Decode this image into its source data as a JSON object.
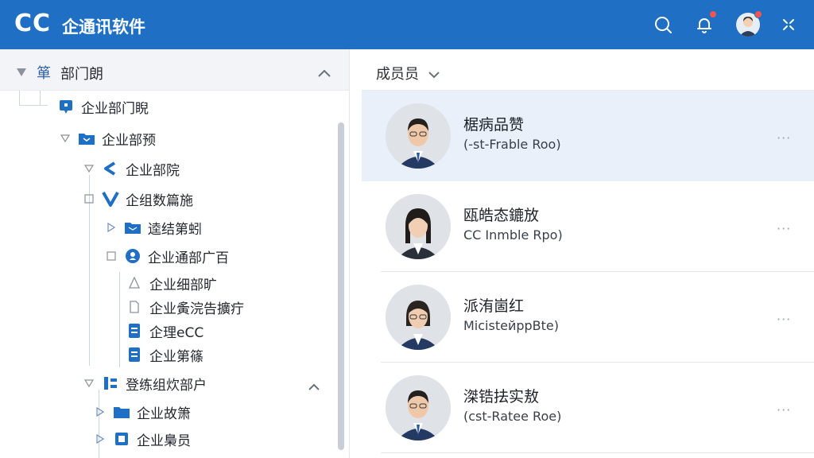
{
  "header": {
    "logo": "CC",
    "title": "企通讯软件",
    "icons": [
      "search-icon",
      "bell-icon",
      "user-avatar",
      "close-icon"
    ],
    "colors": {
      "bar": "#1f6fc4",
      "badge": "#f05454"
    }
  },
  "tree": {
    "header_glyph": "箪",
    "header_label": "部门朗",
    "nodes": [
      {
        "label": "企业部门睨",
        "icon": "chat-bubble-icon"
      },
      {
        "label": "企业部预",
        "icon": "folder-icon"
      },
      {
        "label": "企业部院",
        "icon": "chevron-shape-icon"
      },
      {
        "label": "企组数篇施",
        "icon": "v-logo-icon"
      },
      {
        "label": "逵结第蚓",
        "icon": "folder-icon"
      },
      {
        "label": "企业通部广百",
        "icon": "person-circle-icon"
      },
      {
        "label": "企业细部旷",
        "icon": "outline-icon"
      },
      {
        "label": "企业夤浣告擴疔",
        "icon": "outline-doc-icon"
      },
      {
        "label": "企理eCC",
        "icon": "document-icon"
      },
      {
        "label": "企业第篠",
        "icon": "document-icon"
      },
      {
        "label": "登练组炊部户",
        "icon": "structure-icon"
      },
      {
        "label": "企业故箫",
        "icon": "folder-icon"
      },
      {
        "label": "企业梟员",
        "icon": "square-icon"
      }
    ]
  },
  "members": {
    "header": "成员员",
    "items": [
      {
        "name": "椐病品赞",
        "role": "(-st-Frable Roo)"
      },
      {
        "name": "瓯皓态鏕放",
        "role": "CC Inmble Rpo)"
      },
      {
        "name": "派洧崮红",
        "role": "MicisteйppBte)"
      },
      {
        "name": "滐锆抾实敖",
        "role": "(cst-Ratee Roe)"
      }
    ],
    "more_label": "···"
  }
}
